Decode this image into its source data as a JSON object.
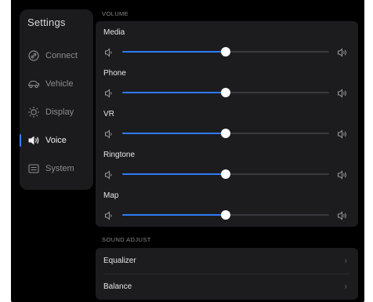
{
  "sidebar": {
    "title": "Settings",
    "items": [
      {
        "label": "Connect",
        "icon": "connect-icon",
        "active": false
      },
      {
        "label": "Vehicle",
        "icon": "vehicle-icon",
        "active": false
      },
      {
        "label": "Display",
        "icon": "display-icon",
        "active": false
      },
      {
        "label": "Voice",
        "icon": "speaker-icon",
        "active": true
      },
      {
        "label": "System",
        "icon": "system-icon",
        "active": false
      }
    ]
  },
  "volume": {
    "section_label": "VOLUME",
    "sliders": [
      {
        "label": "Media",
        "value": 0.5
      },
      {
        "label": "Phone",
        "value": 0.5
      },
      {
        "label": "VR",
        "value": 0.5
      },
      {
        "label": "Ringtone",
        "value": 0.5
      },
      {
        "label": "Map",
        "value": 0.5
      }
    ]
  },
  "sound_adjust": {
    "section_label": "SOUND ADJUST",
    "items": [
      {
        "label": "Equalizer",
        "chevron": "›"
      },
      {
        "label": "Balance",
        "chevron": "›"
      }
    ]
  },
  "colors": {
    "accent": "#2f7bf5",
    "background": "#000000",
    "card": "#1c1c1f"
  }
}
